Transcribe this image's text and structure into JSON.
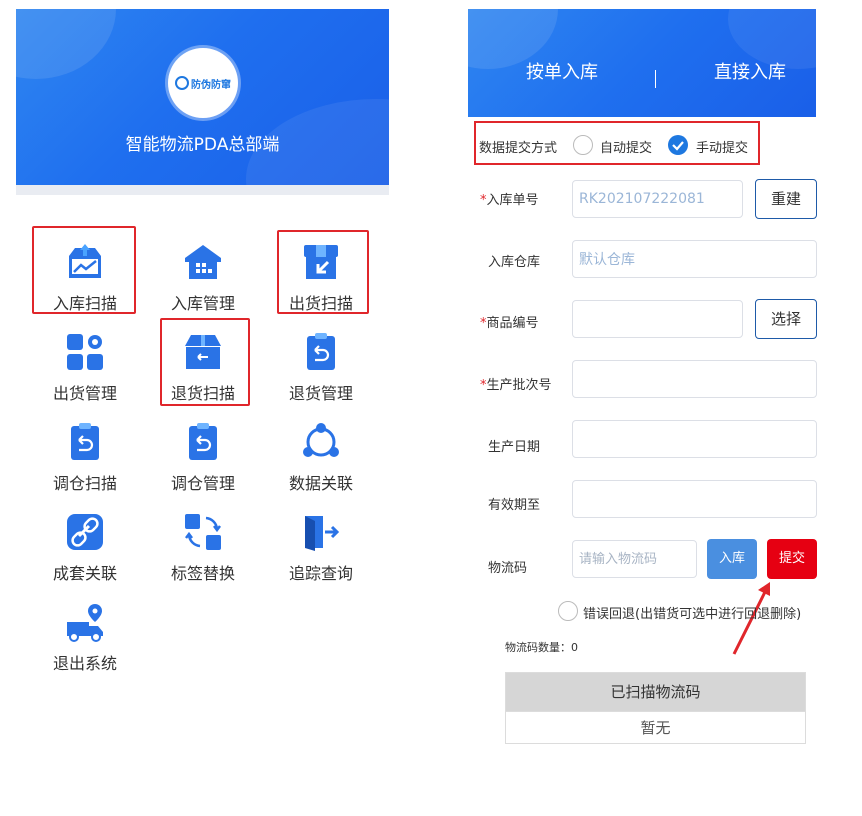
{
  "left": {
    "logo_text": "防伪防窜",
    "app_title": "智能物流PDA总部端",
    "menu": [
      {
        "label": "入库扫描",
        "icon": "inbound-scan-icon",
        "highlighted": true
      },
      {
        "label": "入库管理",
        "icon": "warehouse-icon",
        "highlighted": false
      },
      {
        "label": "出货扫描",
        "icon": "outbound-scan-icon",
        "highlighted": true
      },
      {
        "label": "出货管理",
        "icon": "apps-gear-icon",
        "highlighted": false
      },
      {
        "label": "退货扫描",
        "icon": "return-scan-icon",
        "highlighted": true
      },
      {
        "label": "退货管理",
        "icon": "return-clipboard-icon",
        "highlighted": false
      },
      {
        "label": "调仓扫描",
        "icon": "transfer-clipboard-icon",
        "highlighted": false
      },
      {
        "label": "调仓管理",
        "icon": "transfer-manage-icon",
        "highlighted": false
      },
      {
        "label": "数据关联",
        "icon": "data-link-icon",
        "highlighted": false
      },
      {
        "label": "成套关联",
        "icon": "chain-link-icon",
        "highlighted": false
      },
      {
        "label": "标签替换",
        "icon": "swap-icon",
        "highlighted": false
      },
      {
        "label": "追踪查询",
        "icon": "exit-door-icon",
        "highlighted": false
      },
      {
        "label": "退出系统",
        "icon": "truck-location-icon",
        "highlighted": false
      }
    ]
  },
  "right": {
    "tabs": [
      "按单入库",
      "直接入库"
    ],
    "submit_mode": {
      "label": "数据提交方式",
      "options": [
        "自动提交",
        "手动提交"
      ],
      "selected": "手动提交"
    },
    "fields": {
      "order_no": {
        "label": "入库单号",
        "value": "RK202107222081",
        "button": "重建"
      },
      "warehouse": {
        "label": "入库仓库",
        "value": "默认仓库"
      },
      "product_code": {
        "label": "商品编号",
        "value": "",
        "button": "选择"
      },
      "batch_no": {
        "label": "生产批次号",
        "value": ""
      },
      "prod_date": {
        "label": "生产日期",
        "value": ""
      },
      "expiry": {
        "label": "有效期至",
        "value": ""
      },
      "logistics": {
        "label": "物流码",
        "placeholder": "请输入物流码",
        "in_button": "入库",
        "submit_button": "提交"
      }
    },
    "error_rollback": "错误回退(出错货可选中进行回退删除)",
    "count_label": "物流码数量：0",
    "table": {
      "header": "已扫描物流码",
      "empty": "暂无"
    },
    "colors": {
      "brand": "#1e78e0",
      "highlight": "#e0262b",
      "submit": "#e60012",
      "inbound_btn": "#4a8fe0"
    }
  }
}
